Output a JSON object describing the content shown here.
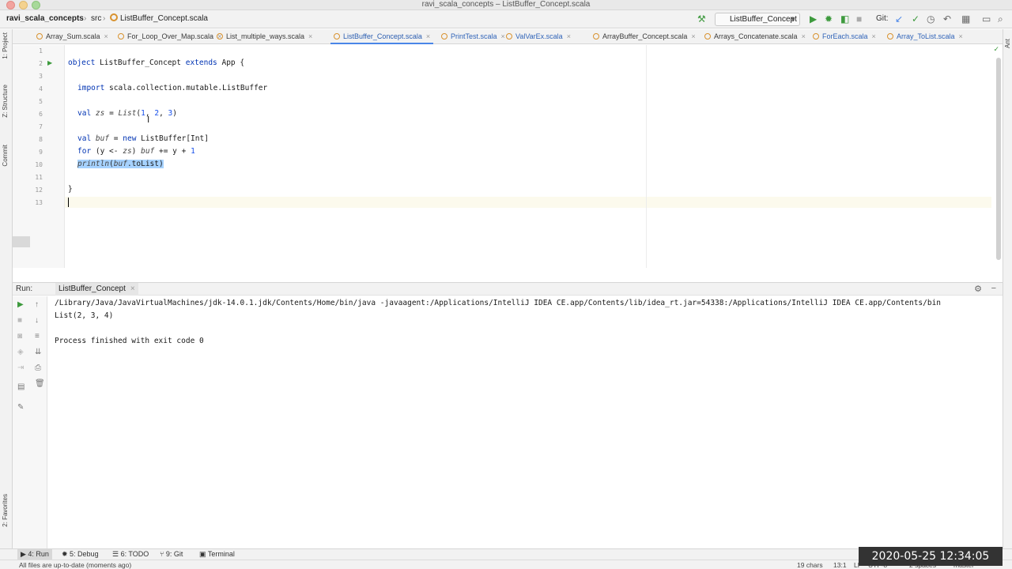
{
  "window": {
    "title": "ravi_scala_concepts – ListBuffer_Concept.scala"
  },
  "breadcrumb": {
    "project": "ravi_scala_concepts",
    "folder": "src",
    "file": "ListBuffer_Concept.scala"
  },
  "toolbar": {
    "run_config": "ListBuffer_Concept",
    "git_label": "Git:"
  },
  "side_labels": {
    "project": "1: Project",
    "structure": "Z: Structure",
    "commit": "Commit",
    "favorites": "2: Favorites",
    "ant": "Ant"
  },
  "tabs": [
    {
      "label": "Array_Sum.scala"
    },
    {
      "label": "For_Loop_Over_Map.scala"
    },
    {
      "label": "List_multiple_ways.scala"
    },
    {
      "label": "ListBuffer_Concept.scala",
      "active": true
    },
    {
      "label": "PrintTest.scala"
    },
    {
      "label": "ValVarEx.scala"
    },
    {
      "label": "ArrayBuffer_Concept.scala"
    },
    {
      "label": "Arrays_Concatenate.scala"
    },
    {
      "label": "ForEach.scala"
    },
    {
      "label": "Array_ToList.scala"
    }
  ],
  "editor": {
    "line_numbers": [
      "1",
      "2",
      "3",
      "4",
      "5",
      "6",
      "7",
      "8",
      "9",
      "10",
      "11",
      "12",
      "13"
    ],
    "lines": {
      "l2": {
        "kw1": "object",
        "name": " ListBuffer_Concept ",
        "kw2": "extends",
        "rest": " App {"
      },
      "l4": {
        "kw": "import",
        "rest": " scala.collection.mutable.ListBuffer"
      },
      "l6": {
        "kw": "val",
        "sp": " ",
        "var": "zs",
        "eq": " = ",
        "fn": "List",
        "open": "(",
        "n1": "1",
        "c1": ", ",
        "n2": "2",
        "c2": ", ",
        "n3": "3",
        "close": ")"
      },
      "l8": {
        "kw": "val",
        "sp": " ",
        "var": "buf",
        "eq": " = ",
        "kw2": "new",
        "rest": " ListBuffer[Int]"
      },
      "l9": {
        "kw": "for",
        "p1": " (y <- ",
        "var1": "zs",
        "p2": ") ",
        "var2": "buf",
        "p3": " += y + ",
        "num": "1"
      },
      "l10": {
        "fn": "println",
        "open": "(",
        "var": "buf",
        "rest": ".toList)"
      },
      "l12": "}"
    }
  },
  "run_panel": {
    "title": "Run:",
    "tab": "ListBuffer_Concept",
    "output": [
      "/Library/Java/JavaVirtualMachines/jdk-14.0.1.jdk/Contents/Home/bin/java -javaagent:/Applications/IntelliJ IDEA CE.app/Contents/lib/idea_rt.jar=54338:/Applications/IntelliJ IDEA CE.app/Contents/bin",
      "List(2, 3, 4)",
      "",
      "Process finished with exit code 0"
    ]
  },
  "bottom_tools": {
    "run": "4: Run",
    "debug": "5: Debug",
    "todo": "6: TODO",
    "git": "9: Git",
    "terminal": "Terminal"
  },
  "status": {
    "message": "All files are up-to-date (moments ago)",
    "chars": "19 chars",
    "position": "13:1",
    "line_sep": "LF",
    "encoding": "UTF-8",
    "indent": "2 spaces",
    "branch": "master"
  },
  "overlay": {
    "timestamp": "2020-05-25  12:34:05"
  }
}
